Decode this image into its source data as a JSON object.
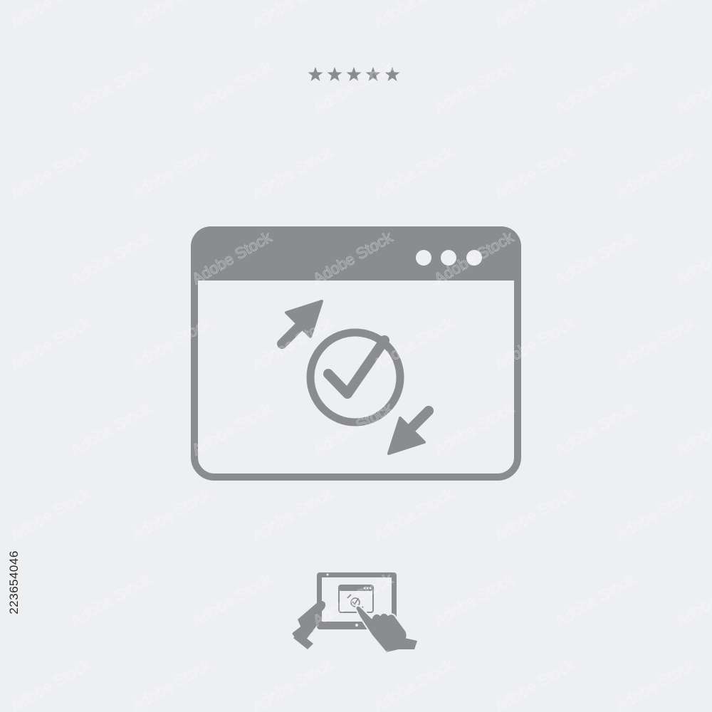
{
  "icon_color": "#8a8c8f",
  "background_color": "#eeeff1",
  "rating": {
    "stars": 5,
    "icon": "star-icon"
  },
  "main_icon": {
    "name": "browser-window-check-icon",
    "window_dots": 3,
    "symbols": [
      "check-circle-icon",
      "arrow-up-right-icon",
      "arrow-down-left-icon"
    ]
  },
  "device_icon": {
    "name": "tablet-touch-icon"
  },
  "side_text": "223654046",
  "watermark_text": "Adobe Stock"
}
